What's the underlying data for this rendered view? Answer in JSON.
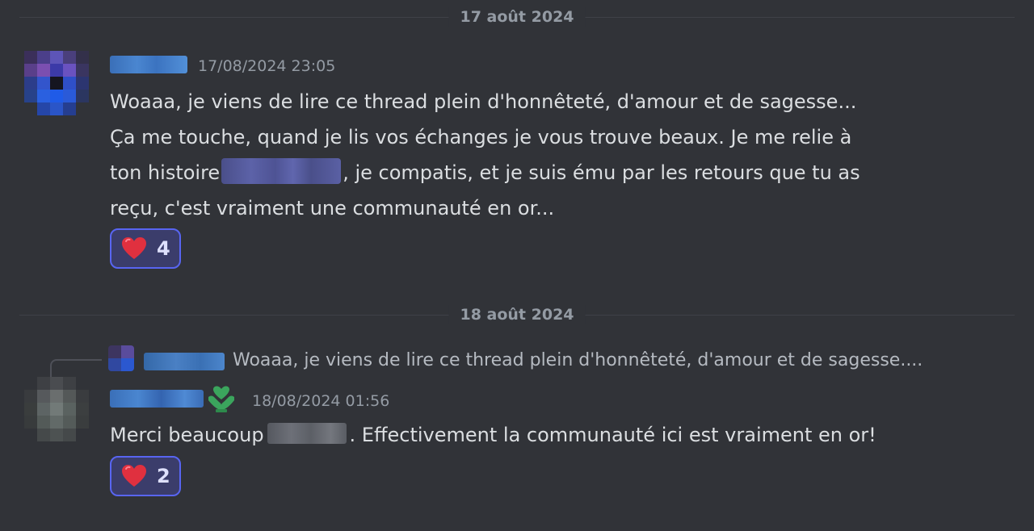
{
  "dividers": {
    "first": "17 août 2024",
    "second": "18 août 2024"
  },
  "message1": {
    "timestamp": "17/08/2024 23:05",
    "lines": {
      "l1": "Woaaa, je viens de lire ce thread plein d'honnêteté, d'amour et de sagesse...",
      "l2": "Ça me touche, quand je lis vos échanges je vous trouve beaux. Je me relie à",
      "l3_before": "ton histoire",
      "l3_after": ", je compatis, et je suis ému par les retours que tu as",
      "l4": "reçu, c'est vraiment une communauté en or..."
    },
    "reaction": {
      "emoji": "heart-icon",
      "count": "4"
    }
  },
  "message2": {
    "reply_preview": "Woaaa, je viens de lire ce thread plein d'honnêteté, d'amour et de sagesse....",
    "timestamp": "18/08/2024 01:56",
    "text_before": "Merci beaucoup",
    "text_after": ". Effectivement la communauté ici est vraiment en or!",
    "reaction": {
      "emoji": "heart-icon",
      "count": "2"
    },
    "role_icon": "green-heart-hands-icon"
  },
  "colors": {
    "background": "#313338",
    "text": "#dbdee1",
    "muted": "#949ba4",
    "reaction_border": "#5865f2",
    "reaction_bg": "#3b3d6b",
    "heart": "#e0303f",
    "role_green": "#3ba55d"
  }
}
